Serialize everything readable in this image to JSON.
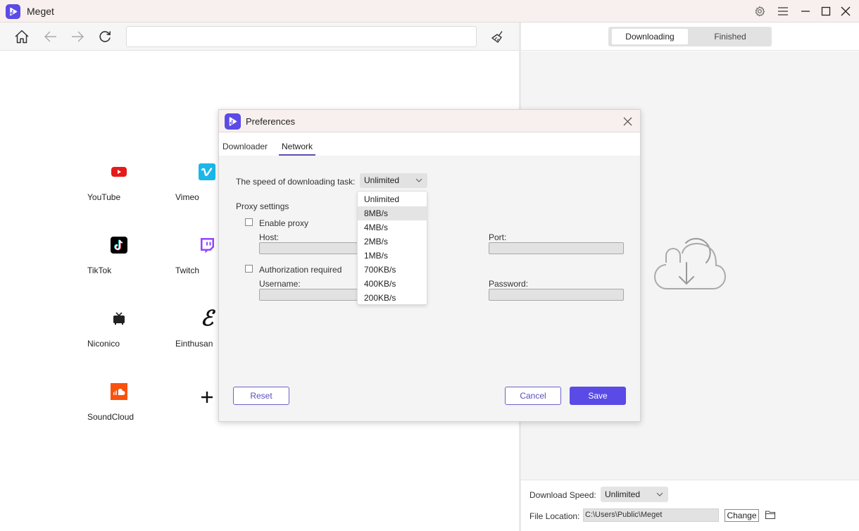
{
  "app": {
    "title": "Meget",
    "brand_color": "#5a4be6"
  },
  "window_controls": {
    "settings_icon": "gear-icon",
    "menu_icon": "hamburger-icon",
    "minimize_icon": "minimize-icon",
    "maximize_icon": "maximize-icon",
    "close_icon": "close-icon"
  },
  "toolbar": {
    "url_value": "",
    "url_placeholder": "",
    "icons": [
      "home-icon",
      "back-arrow-icon",
      "forward-arrow-icon",
      "refresh-icon",
      "broom-icon"
    ]
  },
  "sites": [
    {
      "label": "YouTube",
      "icon": "youtube-icon"
    },
    {
      "label": "Vimeo",
      "icon": "vimeo-icon"
    },
    {
      "label": "TikTok",
      "icon": "tiktok-icon"
    },
    {
      "label": "Twitch",
      "icon": "twitch-icon"
    },
    {
      "label": "Niconico",
      "icon": "niconico-icon"
    },
    {
      "label": "Einthusan",
      "icon": "einthusan-icon"
    },
    {
      "label": "SoundCloud",
      "icon": "soundcloud-icon"
    },
    {
      "label": "",
      "icon": "add-icon"
    }
  ],
  "downloads": {
    "tabs": [
      {
        "label": "Downloading",
        "active": true
      },
      {
        "label": "Finished",
        "active": false
      }
    ],
    "empty_icon": "cloud-download-icon",
    "speed_label": "Download Speed:",
    "speed_value": "Unlimited",
    "location_label": "File Location:",
    "location_value": "C:\\Users\\Public\\Meget",
    "change_label": "Change",
    "folder_icon": "folder-icon"
  },
  "dialog": {
    "title": "Preferences",
    "tabs": [
      {
        "label": "Downloader",
        "active": false
      },
      {
        "label": "Network",
        "active": true
      }
    ],
    "speed_label": "The speed of downloading task:",
    "speed_value": "Unlimited",
    "speed_options": [
      "Unlimited",
      "8MB/s",
      "4MB/s",
      "2MB/s",
      "1MB/s",
      "700KB/s",
      "400KB/s",
      "200KB/s"
    ],
    "hovered_option": "8MB/s",
    "proxy_heading": "Proxy settings",
    "enable_proxy_label": "Enable proxy",
    "enable_proxy_checked": false,
    "host_label": "Host:",
    "host_value": "",
    "port_label": "Port:",
    "port_value": "",
    "auth_label": "Authorization required",
    "auth_checked": false,
    "username_label": "Username:",
    "username_value": "",
    "password_label": "Password:",
    "password_value": "",
    "reset_label": "Reset",
    "cancel_label": "Cancel",
    "save_label": "Save"
  }
}
